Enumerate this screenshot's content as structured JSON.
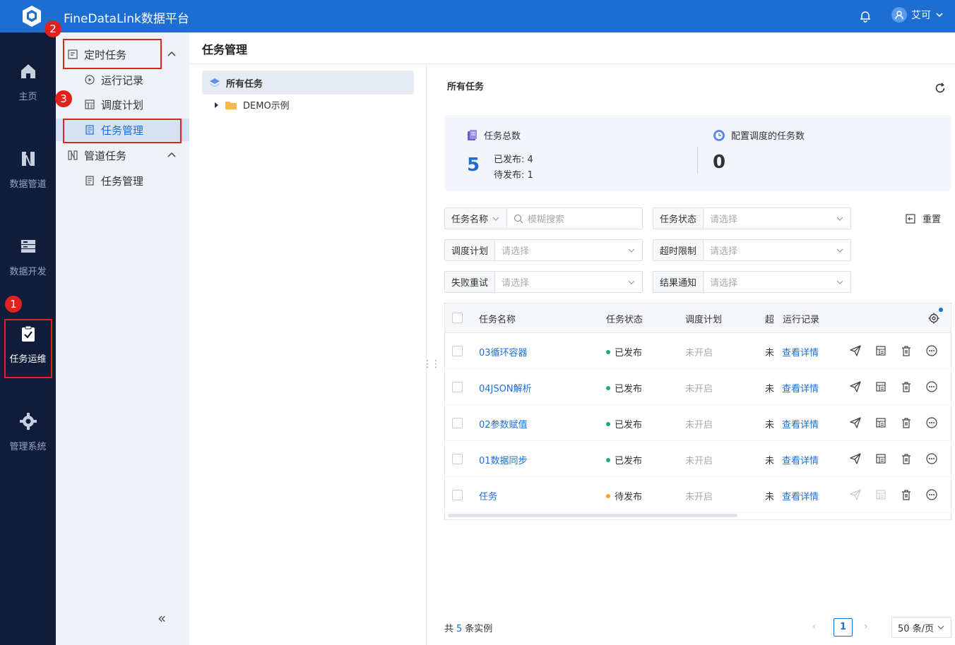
{
  "app": {
    "title": "FineDataLink数据平台",
    "user_name": "艾可"
  },
  "leftnav": {
    "items": [
      {
        "label": "主页",
        "icon": "home-icon"
      },
      {
        "label": "数据管道",
        "icon": "pipeline-icon"
      },
      {
        "label": "数据开发",
        "icon": "database-icon"
      },
      {
        "label": "任务运维",
        "icon": "clipboard-check-icon"
      },
      {
        "label": "管理系统",
        "icon": "gear-icon"
      }
    ]
  },
  "sidebar": {
    "group1": {
      "label": "定时任务",
      "items": [
        "运行记录",
        "调度计划",
        "任务管理"
      ]
    },
    "group2": {
      "label": "管道任务",
      "items": [
        "任务管理"
      ]
    }
  },
  "annotations": {
    "badge1": "1",
    "badge2": "2",
    "badge3": "3"
  },
  "page": {
    "title": "任务管理"
  },
  "tree": {
    "root": "所有任务",
    "child": "DEMO示例"
  },
  "panel": {
    "title": "所有任务"
  },
  "stats": {
    "total_label": "任务总数",
    "total_value": "5",
    "published": "已发布: 4",
    "pending": "待发布: 1",
    "scheduled_label": "配置调度的任务数",
    "scheduled_value": "0"
  },
  "filters": {
    "name_label": "任务名称",
    "search_placeholder": "模糊搜索",
    "status_label": "任务状态",
    "plan_label": "调度计划",
    "timeout_label": "超时限制",
    "retry_label": "失败重试",
    "notify_label": "结果通知",
    "select_placeholder": "请选择",
    "reset": "重置"
  },
  "table": {
    "headers": {
      "name": "任务名称",
      "status": "任务状态",
      "plan": "调度计划",
      "timeout": "超",
      "record": "运行记录"
    },
    "rows": [
      {
        "name": "03循环容器",
        "status": "已发布",
        "status_color": "#23a68a",
        "plan": "未开启",
        "timeout": "未",
        "record": "查看详情",
        "enabled": true
      },
      {
        "name": "04JSON解析",
        "status": "已发布",
        "status_color": "#23a68a",
        "plan": "未开启",
        "timeout": "未",
        "record": "查看详情",
        "enabled": true
      },
      {
        "name": "02参数赋值",
        "status": "已发布",
        "status_color": "#23a68a",
        "plan": "未开启",
        "timeout": "未",
        "record": "查看详情",
        "enabled": true
      },
      {
        "name": "01数据同步",
        "status": "已发布",
        "status_color": "#23a68a",
        "plan": "未开启",
        "timeout": "未",
        "record": "查看详情",
        "enabled": true
      },
      {
        "name": "任务",
        "status": "待发布",
        "status_color": "#f5a623",
        "plan": "未开启",
        "timeout": "未",
        "record": "查看详情",
        "enabled": false
      }
    ]
  },
  "pagination": {
    "prefix": "共",
    "count": "5",
    "suffix": "条实例",
    "current_page": "1",
    "page_size": "50 条/页"
  },
  "colors": {
    "accent": "#1e6ed2",
    "nav_bg": "#0f1c3a",
    "annotation": "#e0221e"
  }
}
